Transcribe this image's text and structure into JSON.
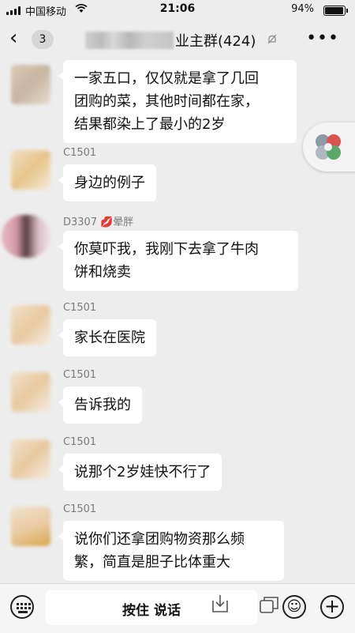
{
  "status_bar": {
    "carrier": "中国移动",
    "wifi_icon": "wifi-icon",
    "time": "21:06",
    "battery_percent": "94%",
    "battery_level": 0.94
  },
  "nav": {
    "back_icon": "chevron-left-icon",
    "unread_count": "3",
    "title_visible": "业主群(424)",
    "mute_icon": "bell-off-icon",
    "more_icon": "more-horizontal-icon"
  },
  "messages": [
    {
      "sender": "",
      "text": "一家五口，仅仅就是拿了几回\n团购的菜，其他时间都在家，\n结果都染上了最小的2岁"
    },
    {
      "sender": "C1501",
      "text": "身边的例子"
    },
    {
      "sender": "D3307",
      "sender_note": "晕胖",
      "text": "你莫吓我，我刚下去拿了牛肉\n饼和烧卖"
    },
    {
      "sender": "C1501",
      "text": "家长在医院"
    },
    {
      "sender": "C1501",
      "text": "告诉我的"
    },
    {
      "sender": "C1501",
      "text": "说那个2岁娃快不行了"
    },
    {
      "sender": "C1501",
      "text": "说你们还拿团购物资那么频\n繁，简直是胆子比体重大"
    }
  ],
  "input_bar": {
    "keyboard_icon": "keyboard-icon",
    "hold_to_talk": "按住 说话",
    "emoji_icon": "emoji-icon",
    "plus_icon": "plus-circle-icon"
  },
  "colors": {
    "background": "#ededed",
    "bubble": "#ffffff",
    "sender_text": "#7a7a7a"
  }
}
